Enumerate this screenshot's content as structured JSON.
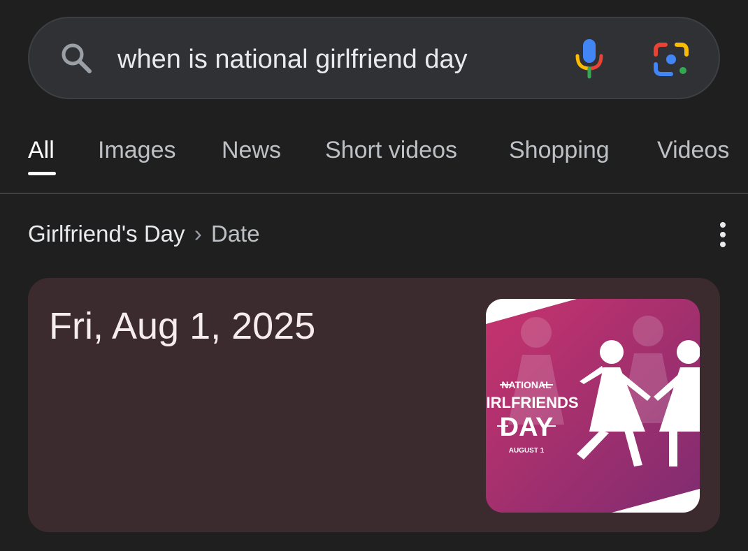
{
  "search": {
    "query": "when is national girlfriend day",
    "icons": {
      "search": "search-icon",
      "voice": "mic-icon",
      "lens": "lens-icon"
    }
  },
  "tabs": [
    {
      "label": "All",
      "active": true
    },
    {
      "label": "Images"
    },
    {
      "label": "News"
    },
    {
      "label": "Short videos"
    },
    {
      "label": "Shopping"
    },
    {
      "label": "Videos"
    }
  ],
  "result": {
    "breadcrumb": {
      "entity": "Girlfriend's Day",
      "separator": "›",
      "attribute": "Date"
    },
    "answer": "Fri, Aug 1, 2025",
    "image": {
      "line1": "NATIONAL",
      "line2": "GIRLFRIENDS",
      "line3": "DAY",
      "line4": "AUGUST 1"
    }
  },
  "colors": {
    "background": "#1f1f1f",
    "search_bar": "#303134",
    "card": "#3b2b2e",
    "image_pink": "#c2306a",
    "image_purple": "#8a2f72"
  }
}
